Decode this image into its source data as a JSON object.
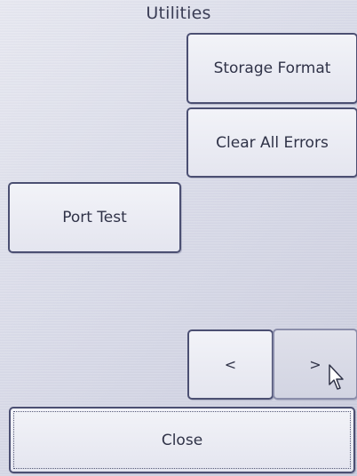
{
  "screen": {
    "title": "Utilities"
  },
  "buttons": {
    "storage_format": "Storage Format",
    "clear_all_errors": "Clear All Errors",
    "port_test": "Port Test",
    "prev": "<",
    "next": ">",
    "close": "Close"
  },
  "icons": {
    "cursor": "mouse-pointer-icon"
  },
  "colors": {
    "background": "#d9dbe8",
    "button_border": "#4b4f72",
    "button_fill": "#eceef5",
    "text": "#2f3247"
  }
}
